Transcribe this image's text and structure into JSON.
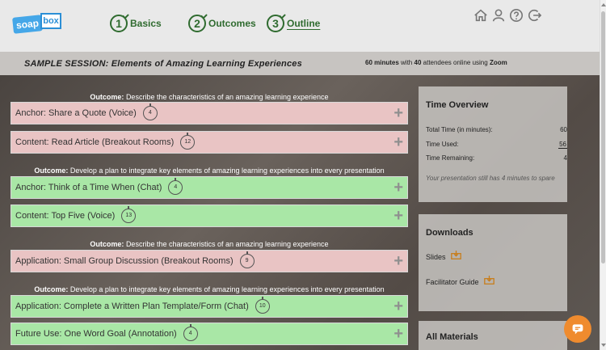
{
  "logo": {
    "part1": "soap",
    "part2": "box"
  },
  "steps": [
    {
      "num": "1",
      "label": "Basics"
    },
    {
      "num": "2",
      "label": "Outcomes"
    },
    {
      "num": "3",
      "label": "Outline"
    }
  ],
  "top_icons": [
    "home-icon",
    "user-icon",
    "help-icon",
    "logout-icon"
  ],
  "session": {
    "title": "SAMPLE SESSION: Elements of Amazing Learning Experiences",
    "minutes": "60 minutes",
    "with": "with",
    "attendees": "40",
    "attendees_text": "attendees online using",
    "platform": "Zoom"
  },
  "outline": {
    "outcome_prefix": "Outcome:",
    "outcomes": [
      "Describe the characteristics of an amazing learning experience",
      "Develop a plan to integrate key elements of amazing learning experiences into every presentation",
      "Describe the characteristics of an amazing learning experience",
      "Develop a plan to integrate key elements of amazing learning experiences into every presentation"
    ],
    "activities": [
      {
        "title": "Anchor: Share a Quote (Voice)",
        "minutes": "4",
        "color": "#e9c4c4"
      },
      {
        "title": "Content: Read Article (Breakout Rooms)",
        "minutes": "12",
        "color": "#e9c4c4"
      },
      {
        "title": "Anchor: Think of a Time When (Chat)",
        "minutes": "4",
        "color": "#a9e7a6"
      },
      {
        "title": "Content: Top Five (Voice)",
        "minutes": "13",
        "color": "#a9e7a6"
      },
      {
        "title": "Application: Small Group Discussion (Breakout Rooms)",
        "minutes": "9",
        "color": "#e9c4c4"
      },
      {
        "title": "Application: Complete a Written Plan Template/Form (Chat)",
        "minutes": "10",
        "color": "#a9e7a6"
      },
      {
        "title": "Future Use: One Word Goal (Annotation)",
        "minutes": "4",
        "color": "#a9e7a6"
      }
    ],
    "add_symbol": "+"
  },
  "time_overview": {
    "title": "Time Overview",
    "total_label": "Total Time (in minutes):",
    "total_value": "60",
    "used_label": "Time Used:",
    "used_value": "56",
    "remaining_label": "Time Remaining:",
    "remaining_value": "4",
    "note": "Your presentation still has 4 minutes to spare"
  },
  "downloads": {
    "title": "Downloads",
    "slides_label": "Slides",
    "facilitator_label": "Facilitator Guide"
  },
  "all_materials": {
    "title": "All Materials"
  },
  "colors": {
    "accent_green": "#2f6b2f",
    "chat_orange": "#ef8b2e",
    "logo_blue": "#45a7e8"
  }
}
